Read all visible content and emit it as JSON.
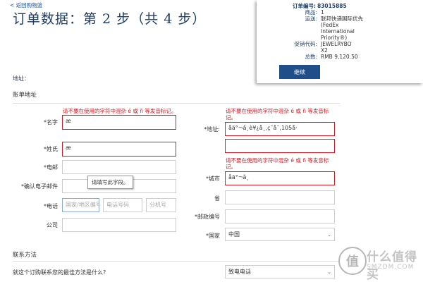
{
  "header": {
    "back_link": "< 返回购物篮",
    "title": "订单数据：第 2 步（共 4 步）",
    "address_label": "地址："
  },
  "summary": {
    "order_no_label": "订单编号:",
    "order_no": "83015885",
    "items_label": "商品:",
    "items": "1",
    "shipping_label": "运送:",
    "shipping": "联邦快递国际优先 (FedEx International Priority®)",
    "promo_label": "促销代码:",
    "promo": "JEWELRYBOX2",
    "total_label": "总数:",
    "total": "RMB 9,120.50",
    "continue": "继续"
  },
  "billing": {
    "section_title": "账单地址",
    "error_text": "请不要在使用的字符中混杂 é 或 ñ 等发音标记。",
    "error_text_right": "请不要在使用的字符中混杂 é 或 ñ 等发音标记。",
    "name_label": "*名字",
    "name_value": "æ",
    "surname_label": "*姓氏",
    "surname_value": "æ",
    "email_label": "*电邮",
    "confirm_email_label": "*确认电子邮件",
    "tooltip": "请填写此字段。",
    "phone_label": "*电话",
    "phone_ph_area": "国家/地区编号",
    "phone_ph_number": "电话号码",
    "phone_ph_ext": "分机号",
    "company_label": "公司",
    "address_label": "*地址:",
    "address_value": "åä°¬â¸è¥¿å¸‚ç˜å¯‚105å·",
    "city_label": "*城市",
    "city_value": "åä°¬â¸",
    "province_label": "省",
    "postcode_label": "*邮政编号",
    "country_label": "*国家",
    "country_value": "中国"
  },
  "contact": {
    "section_title": "联系方法",
    "question": "就这个订购联系您的最佳方法是什么?",
    "method_value": "致电电话"
  },
  "watermark": {
    "logo": "值",
    "text": "什么值得买",
    "sub": "SMZDM.COM"
  }
}
